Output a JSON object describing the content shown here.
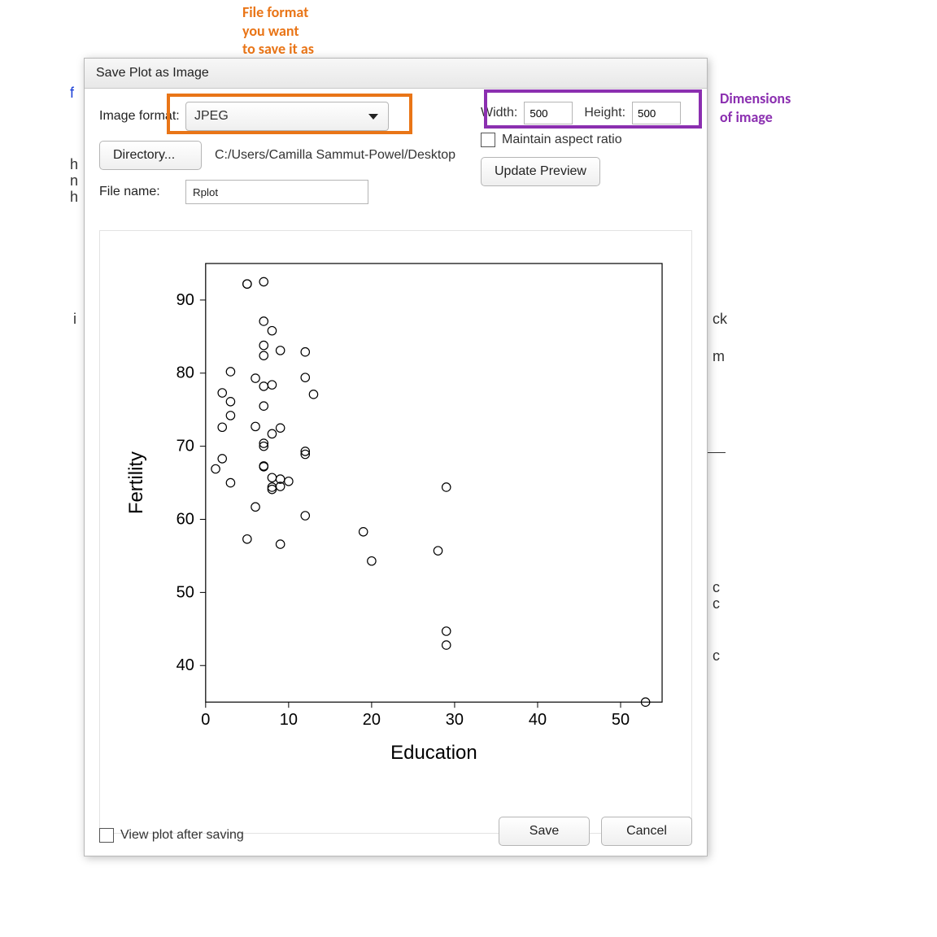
{
  "annotations": {
    "fileformat_line1": "File format",
    "fileformat_line2": "you want",
    "fileformat_line3": "to save it as",
    "dimensions_line1": "Dimensions",
    "dimensions_line2": "of image"
  },
  "dialog": {
    "title": "Save Plot as Image",
    "image_format_label": "Image format:",
    "image_format_value": "JPEG",
    "directory_button": "Directory...",
    "directory_path": "C:/Users/Camilla Sammut-Powel/Desktop",
    "filename_label": "File name:",
    "filename_value": "Rplot",
    "width_label": "Width:",
    "width_value": "500",
    "height_label": "Height:",
    "height_value": "500",
    "maintain_aspect_label": "Maintain aspect ratio",
    "update_preview_label": "Update Preview",
    "view_after_label": "View plot after saving",
    "save_label": "Save",
    "cancel_label": "Cancel"
  },
  "chart_data": {
    "type": "scatter",
    "xlabel": "Education",
    "ylabel": "Fertility",
    "xlim": [
      0,
      55
    ],
    "ylim": [
      35,
      95
    ],
    "x_ticks": [
      0,
      10,
      20,
      30,
      40,
      50
    ],
    "y_ticks": [
      40,
      50,
      60,
      70,
      80,
      90
    ],
    "points": [
      {
        "x": 1.2,
        "y": 66.9
      },
      {
        "x": 2,
        "y": 68.3
      },
      {
        "x": 2,
        "y": 72.6
      },
      {
        "x": 2,
        "y": 77.3
      },
      {
        "x": 3,
        "y": 65.0
      },
      {
        "x": 3,
        "y": 74.2
      },
      {
        "x": 3,
        "y": 76.1
      },
      {
        "x": 3,
        "y": 80.2
      },
      {
        "x": 5,
        "y": 57.3
      },
      {
        "x": 5,
        "y": 92.2
      },
      {
        "x": 5,
        "y": 92.2
      },
      {
        "x": 6,
        "y": 61.7
      },
      {
        "x": 6,
        "y": 72.7
      },
      {
        "x": 6,
        "y": 79.3
      },
      {
        "x": 7,
        "y": 67.2
      },
      {
        "x": 7,
        "y": 67.3
      },
      {
        "x": 7,
        "y": 70.0
      },
      {
        "x": 7,
        "y": 70.4
      },
      {
        "x": 7,
        "y": 75.5
      },
      {
        "x": 7,
        "y": 78.2
      },
      {
        "x": 7,
        "y": 82.4
      },
      {
        "x": 7,
        "y": 83.8
      },
      {
        "x": 7,
        "y": 87.1
      },
      {
        "x": 7,
        "y": 92.5
      },
      {
        "x": 8,
        "y": 64.1
      },
      {
        "x": 8,
        "y": 64.4
      },
      {
        "x": 8,
        "y": 65.7
      },
      {
        "x": 8,
        "y": 71.7
      },
      {
        "x": 8,
        "y": 78.4
      },
      {
        "x": 8,
        "y": 85.8
      },
      {
        "x": 9,
        "y": 56.6
      },
      {
        "x": 9,
        "y": 64.5
      },
      {
        "x": 9,
        "y": 65.5
      },
      {
        "x": 9,
        "y": 72.5
      },
      {
        "x": 9,
        "y": 83.1
      },
      {
        "x": 10,
        "y": 65.2
      },
      {
        "x": 12,
        "y": 60.5
      },
      {
        "x": 12,
        "y": 68.9
      },
      {
        "x": 12,
        "y": 69.3
      },
      {
        "x": 12,
        "y": 79.4
      },
      {
        "x": 12,
        "y": 82.9
      },
      {
        "x": 13,
        "y": 77.1
      },
      {
        "x": 19,
        "y": 58.3
      },
      {
        "x": 20,
        "y": 54.3
      },
      {
        "x": 28,
        "y": 55.7
      },
      {
        "x": 29,
        "y": 64.4
      },
      {
        "x": 29,
        "y": 44.7
      },
      {
        "x": 29,
        "y": 42.8
      },
      {
        "x": 53,
        "y": 35.0
      }
    ]
  },
  "bg": {
    "left_f": "f",
    "left_h1": "h",
    "left_n": "n",
    "left_h2": "h",
    "left_i": "i",
    "right_ck": "ck",
    "right_m": "m",
    "right_c1": "c",
    "right_c2": "c",
    "right_c3": "c"
  }
}
